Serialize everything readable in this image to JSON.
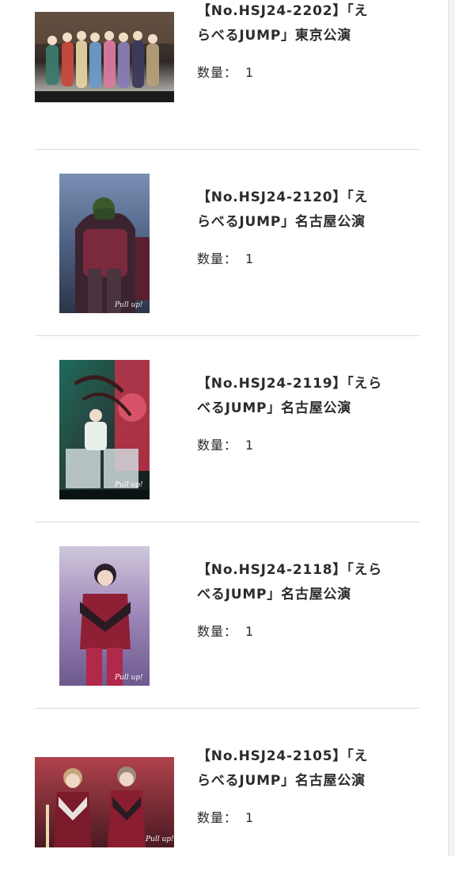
{
  "items": [
    {
      "title_lines": [
        "【No.HSJ24-2202】「え",
        "らべるJUMP」東京公演"
      ],
      "qty_label": "数量：",
      "qty_value": "1",
      "thumb_alt": "group-photo"
    },
    {
      "title_lines": [
        "【No.HSJ24-2120】「え",
        "らべるJUMP」名古屋公演"
      ],
      "qty_label": "数量：",
      "qty_value": "1",
      "thumb_alt": "solo-photo"
    },
    {
      "title_lines": [
        "【No.HSJ24-2119】「えら",
        "べるJUMP」名古屋公演"
      ],
      "qty_label": "数量：",
      "qty_value": "1",
      "thumb_alt": "solo-photo"
    },
    {
      "title_lines": [
        "【No.HSJ24-2118】「えら",
        "べるJUMP」名古屋公演"
      ],
      "qty_label": "数量：",
      "qty_value": "1",
      "thumb_alt": "solo-photo"
    },
    {
      "title_lines": [
        "【No.HSJ24-2105】「え",
        "らべるJUMP」名古屋公演"
      ],
      "qty_label": "数量：",
      "qty_value": "1",
      "thumb_alt": "duo-photo"
    }
  ],
  "colors": {
    "text": "#2b2b2b",
    "divider": "#dcdcdc",
    "background": "#ffffff"
  }
}
